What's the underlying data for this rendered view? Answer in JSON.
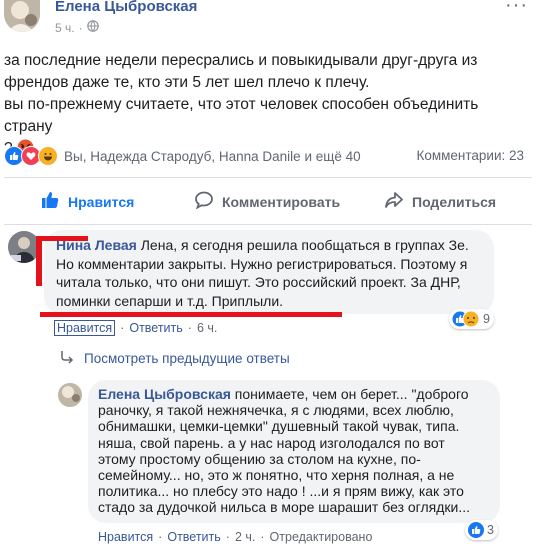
{
  "post": {
    "author": "Елена Цыбровская",
    "time": "5 ч.",
    "more_label": "···",
    "text_lines": [
      "за последние недели пересрались и повыкидывали друг-друга из",
      "френдов даже те, кто эти 5 лет шел плечо к плечу.",
      "вы по-прежнему считаете, что этот человек способен объединить страну",
      "?"
    ],
    "reactions_text": "Вы, Надежда Стародуб, Hanna Danile и ещё 40",
    "comments_count": "Комментарии: 23"
  },
  "actions": {
    "like": "Нравится",
    "comment": "Комментировать",
    "share": "Поделиться"
  },
  "comment1": {
    "author": "Нина Левая",
    "text_lines": [
      "Лена, я сегодня решила пообщаться в группах Зе.",
      "Но комментарии закрыты. Нужно регистрироваться. Поэтому я",
      "читала только, что они пишут. Это российский проект. За ДНР,",
      "поминки сепарши и т.д. Приплыли."
    ],
    "like": "Нравится",
    "reply": "Ответить",
    "time": "6 ч.",
    "reaction_count": "9"
  },
  "view_previous": "Посмотреть предыдущие ответы",
  "reply1": {
    "author": "Елена Цыбровская",
    "text_lines": [
      "понимаете, чем он берет... \"доброго",
      "раночку, я такой нежнячечка, я с людями, всех люблю,",
      "обнимашки, цемки-цемки\" душевный такой чувак, типа.",
      "няша, свой парень. а у нас народ изголодался по вот",
      "этому простому общению за столом на кухне, по-",
      "семейному... но, это ж понятно, что херня полная, а не",
      "политика... но плебсу это надо ! ...и я прям вижу, как это",
      "стадо за дудочкой нильса в море шарашит без оглядки..."
    ],
    "like": "Нравится",
    "reply": "Ответить",
    "time": "2 ч.",
    "edited": "Отредактировано",
    "reaction_count": "3"
  },
  "colors": {
    "link_blue": "#385898",
    "like_blue": "#1877f2",
    "love_red": "#f33e58",
    "haha_yellow": "#f7b125",
    "annotation_red": "#e4121a"
  }
}
